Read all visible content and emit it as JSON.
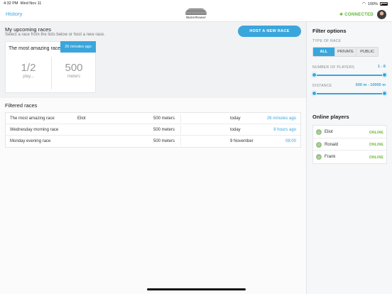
{
  "status_bar": {
    "time": "4:32 PM",
    "date": "Wed Nov 11",
    "battery": "100%"
  },
  "nav": {
    "back_label": "History",
    "logo_text": "WaterRower",
    "connection_status": "CONNECTED",
    "connection_color": "#5bb82e"
  },
  "upcoming": {
    "title": "My upcoming races",
    "subtitle": "Select a race from the lists below or host a new race.",
    "host_button": "HOST A NEW RACE",
    "card": {
      "name": "The most amazing race",
      "badge": "26 minutes ago",
      "players_value": "1/2",
      "players_label": "play...",
      "distance_value": "500",
      "distance_label": "meters"
    }
  },
  "filtered": {
    "title": "Filtered races",
    "rows": [
      {
        "name": "The most amazing race",
        "host": "Eliot",
        "distance": "500 meters",
        "day": "today",
        "time": "26 minutes ago"
      },
      {
        "name": "Wednesday morning race",
        "host": "",
        "distance": "500 meters",
        "day": "today",
        "time": "8 hours ago"
      },
      {
        "name": "Monday evening race",
        "host": "",
        "distance": "500 meters",
        "day": "9 November",
        "time": "08:00"
      }
    ]
  },
  "filters": {
    "title": "Filter options",
    "type_label": "TYPE OF RACE",
    "types": [
      "ALL",
      "PRIVATE",
      "PUBLIC"
    ],
    "selected_type": "ALL",
    "players_label": "NUMBER OF PLAYERS",
    "players_value": "1 - 8",
    "distance_label": "DISTANCE",
    "distance_value": "500 m - 10000 m"
  },
  "online": {
    "title": "Online players",
    "players": [
      {
        "name": "Eliot",
        "status": "ONLINE"
      },
      {
        "name": "Ronald",
        "status": "ONLINE"
      },
      {
        "name": "Frank",
        "status": "ONLINE"
      }
    ]
  },
  "colors": {
    "accent": "#3aa6dc",
    "online": "#6cbb2f"
  }
}
